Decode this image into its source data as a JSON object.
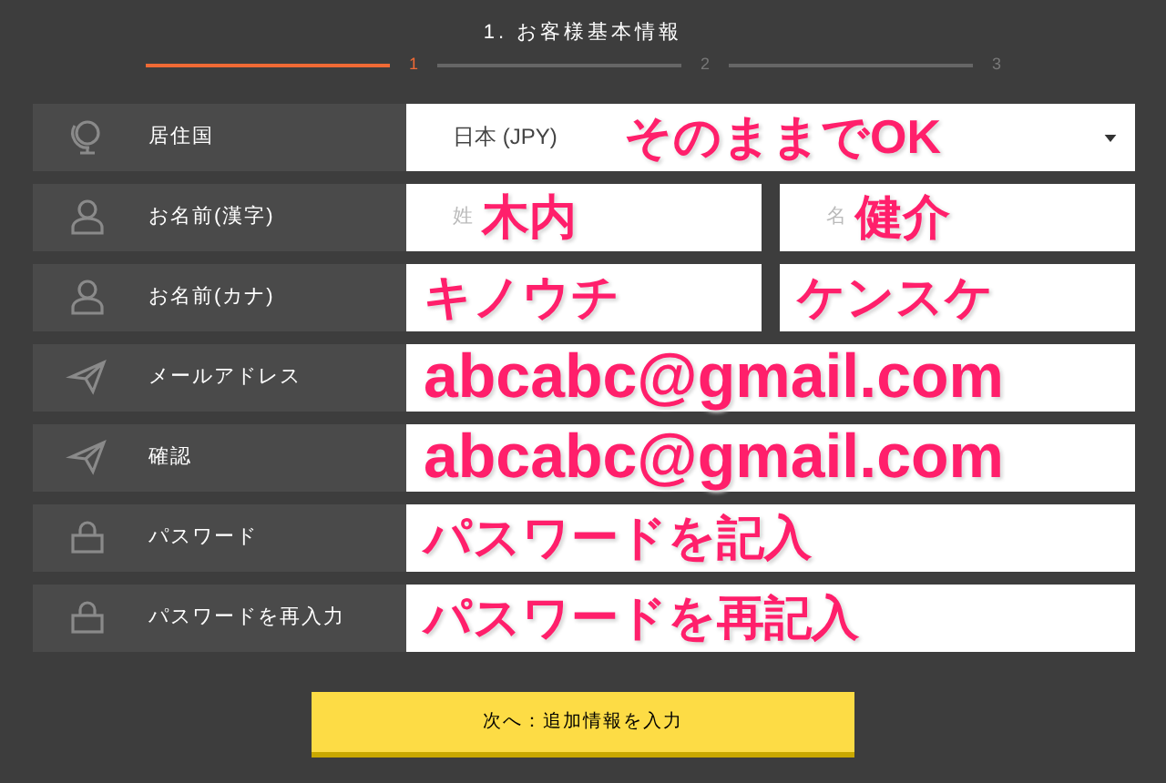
{
  "steps": {
    "title": "1. お客様基本情報",
    "items": [
      {
        "label": "1",
        "selected": true
      },
      {
        "label": "2",
        "selected": false
      },
      {
        "label": "3",
        "selected": false
      }
    ]
  },
  "rows": [
    {
      "label": "居住国",
      "kind": "select",
      "value": "日本 (JPY)",
      "annotation": "そのままでOK"
    },
    {
      "label": "お名前(漢字)",
      "kind": "split",
      "fields": [
        {
          "placeholder": "姓",
          "annotation": "木内"
        },
        {
          "placeholder": "名",
          "annotation": "健介"
        }
      ]
    },
    {
      "label": "お名前(カナ)",
      "kind": "split",
      "fields": [
        {
          "annotation": "キノウチ"
        },
        {
          "annotation": "ケンスケ"
        }
      ]
    },
    {
      "label": "メールアドレス",
      "kind": "text",
      "annotation": "abcabc@gmail.com"
    },
    {
      "label": "確認",
      "kind": "text",
      "annotation": "abcabc@gmail.com"
    },
    {
      "label": "パスワード",
      "kind": "text",
      "annotation": "パスワードを記入"
    },
    {
      "label": "パスワードを再入力",
      "kind": "text",
      "annotation": "パスワードを再記入"
    }
  ],
  "next_button": "次へ：追加情報を入力"
}
